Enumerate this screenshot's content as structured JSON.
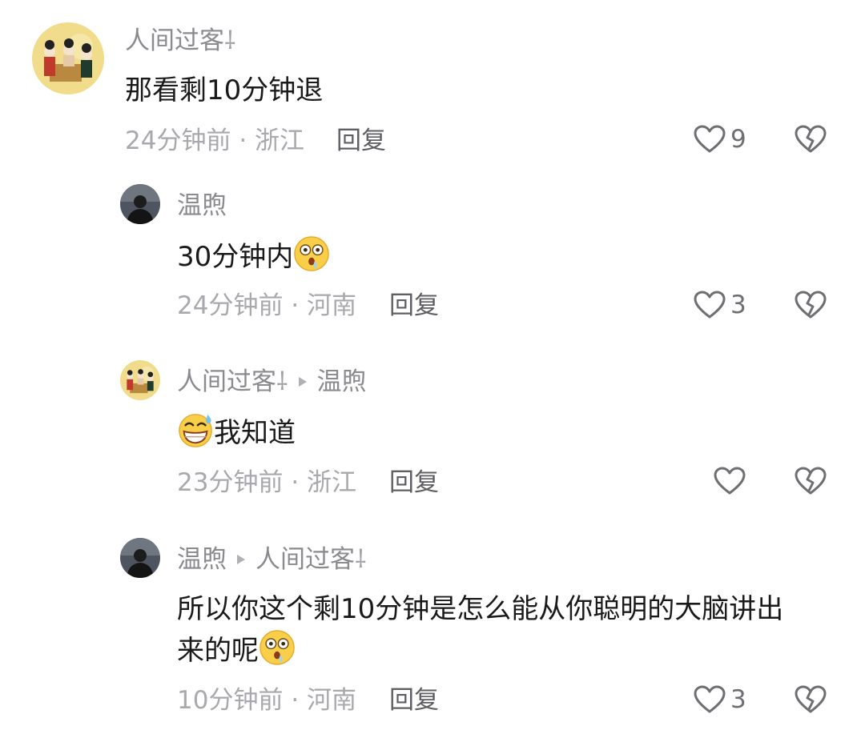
{
  "comments": [
    {
      "user": "人间过客",
      "user_deco": "⸸",
      "text": "那看剩10分钟退",
      "time": "24分钟前",
      "separator": "·",
      "location": "浙江",
      "reply_label": "回复",
      "likes": "9"
    },
    {
      "user": "温煦",
      "text": "30分钟内",
      "text_emoji": "surprised-face-emoji",
      "time": "24分钟前",
      "separator": "·",
      "location": "河南",
      "reply_label": "回复",
      "likes": "3"
    },
    {
      "user": "人间过客",
      "user_deco": "⸸",
      "reply_to": "温煦",
      "text_emoji": "grinning-sweat-emoji",
      "text": "我知道",
      "time": "23分钟前",
      "separator": "·",
      "location": "浙江",
      "reply_label": "回复",
      "likes": ""
    },
    {
      "user": "温煦",
      "reply_to": "人间过客",
      "reply_to_deco": "⸸",
      "text_line1": "所以你这个剩10分钟是怎么能从你聪明的大脑讲出",
      "text_line2": "来的呢",
      "text_emoji": "surprised-face-emoji",
      "time": "10分钟前",
      "separator": "·",
      "location": "河南",
      "reply_label": "回复",
      "likes": "3"
    }
  ],
  "icons": {
    "like": "heart-outline-icon",
    "dislike": "broken-heart-icon",
    "reply_arrow": "play-arrow-icon"
  },
  "colors": {
    "name": "#8a8a8f",
    "text": "#1a1a1a",
    "meta": "#a8a8ad",
    "icon": "#6f6f73"
  }
}
